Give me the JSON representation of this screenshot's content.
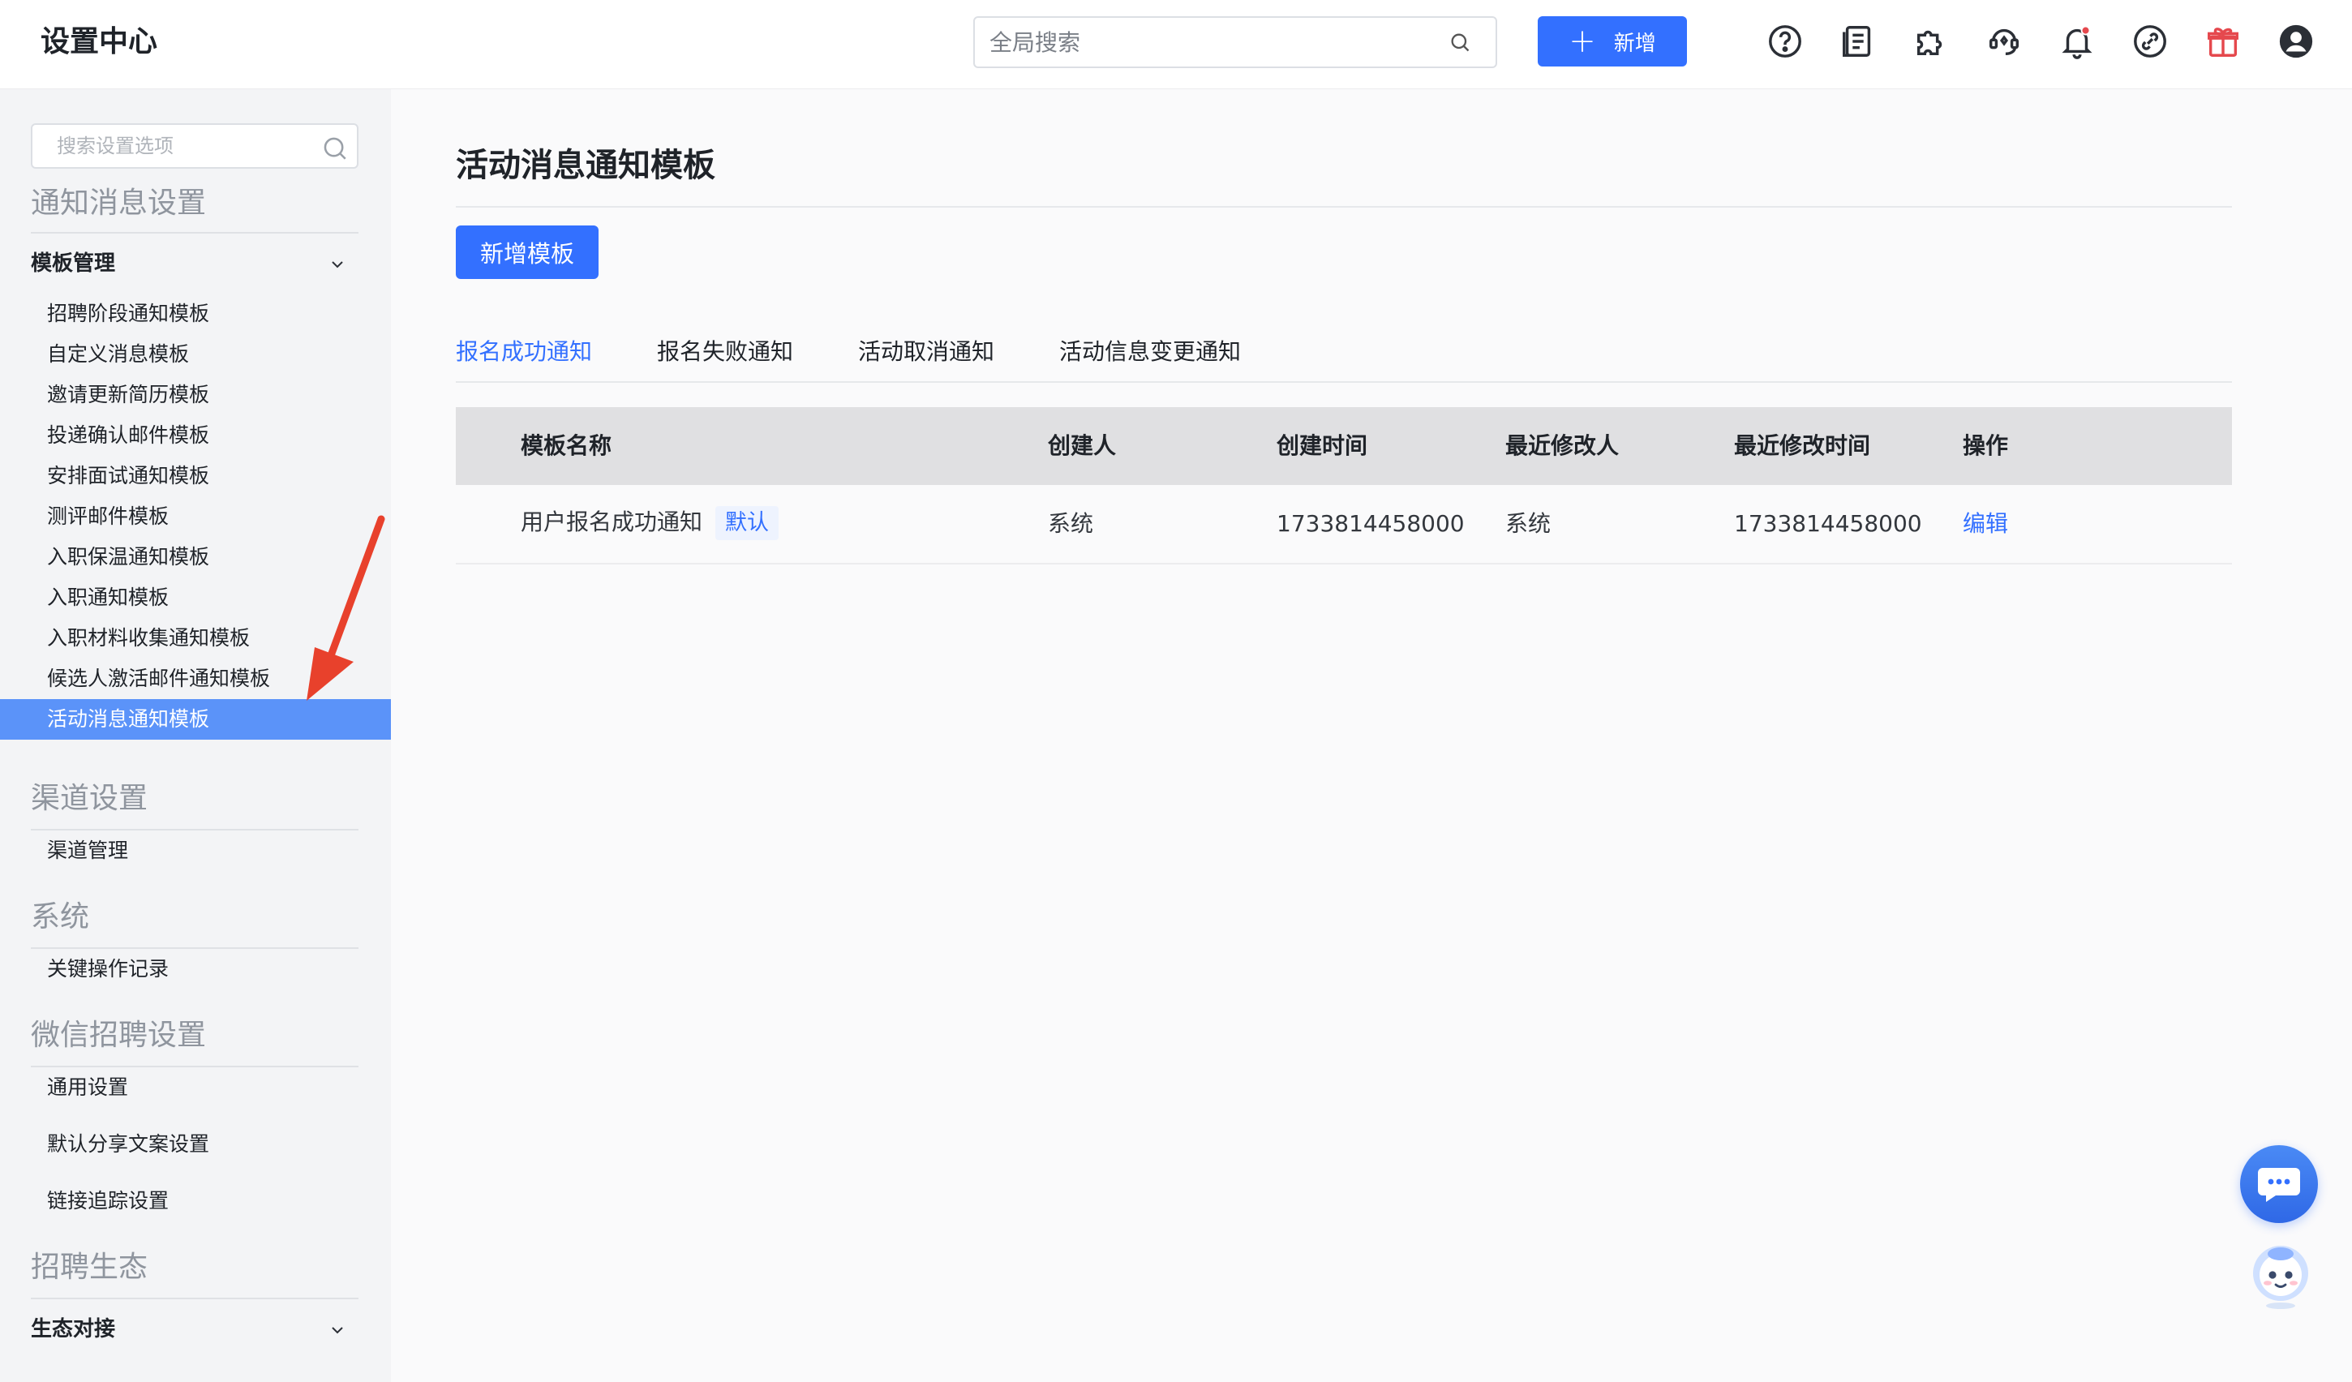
{
  "header": {
    "title": "设置中心",
    "search_placeholder": "全局搜索",
    "add_label": "新增",
    "notification_badge_color": "#e5484d"
  },
  "sidebar": {
    "search_placeholder": "搜索设置选项",
    "groups": [
      {
        "title": "通知消息设置"
      },
      {
        "title": "渠道设置"
      },
      {
        "title": "系统"
      },
      {
        "title": "微信招聘设置"
      },
      {
        "title": "招聘生态"
      }
    ],
    "template_head": "模板管理",
    "template_items": [
      "招聘阶段通知模板",
      "自定义消息模板",
      "邀请更新简历模板",
      "投递确认邮件模板",
      "安排面试通知模板",
      "测评邮件模板",
      "入职保温通知模板",
      "入职通知模板",
      "入职材料收集通知模板",
      "候选人激活邮件通知模板",
      "活动消息通知模板"
    ],
    "channel_items": [
      "渠道管理"
    ],
    "system_items": [
      "关键操作记录"
    ],
    "wechat_items": [
      "通用设置",
      "默认分享文案设置",
      "链接追踪设置"
    ],
    "eco_head": "生态对接"
  },
  "main": {
    "page_title": "活动消息通知模板",
    "new_template_label": "新增模板",
    "tabs": [
      "报名成功通知",
      "报名失败通知",
      "活动取消通知",
      "活动信息变更通知"
    ],
    "table": {
      "headers": [
        "模板名称",
        "创建人",
        "创建时间",
        "最近修改人",
        "最近修改时间",
        "操作"
      ],
      "rows": [
        {
          "name": "用户报名成功通知",
          "badge": "默认",
          "creator": "系统",
          "created_at": "1733814458000",
          "modifier": "系统",
          "modified_at": "1733814458000",
          "action": "编辑"
        }
      ]
    }
  },
  "colors": {
    "primary": "#3370ff",
    "sidebar_active": "#5b93f9",
    "annotation_arrow": "#e8412c"
  }
}
